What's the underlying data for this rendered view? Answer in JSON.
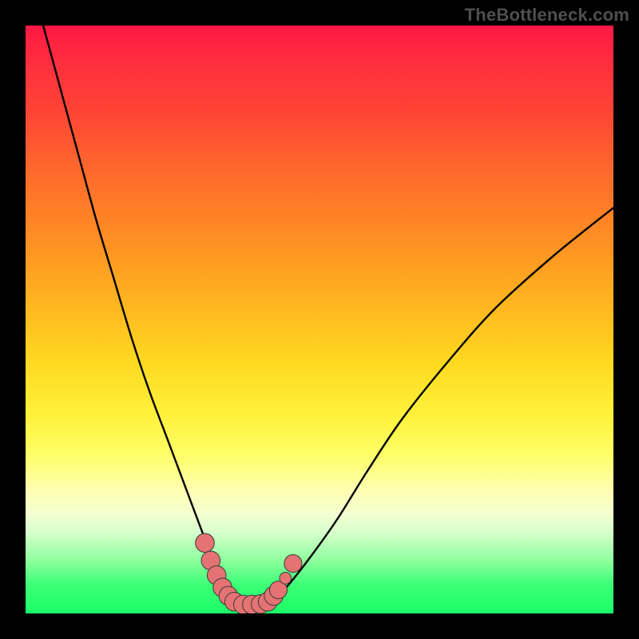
{
  "watermark": "TheBottleneck.com",
  "colors": {
    "curve_stroke": "#000000",
    "marker_fill": "#e57373",
    "marker_stroke": "#3a3a3a",
    "frame_bg": "#000000"
  },
  "chart_data": {
    "type": "line",
    "title": "",
    "xlabel": "",
    "ylabel": "",
    "xlim": [
      0,
      100
    ],
    "ylim": [
      0,
      100
    ],
    "grid": false,
    "series": [
      {
        "name": "bottleneck-curve",
        "comment": "V-shaped bottleneck percentage curve; y is percent bottleneck vs x (hardware balance). Values estimated from pixel positions.",
        "x": [
          3,
          6,
          9,
          12,
          15,
          18,
          21,
          24,
          27,
          30,
          32,
          34,
          35,
          36,
          38,
          40,
          42,
          44,
          48,
          53,
          58,
          64,
          72,
          80,
          90,
          100
        ],
        "y": [
          100,
          89,
          78,
          67,
          57,
          47,
          38,
          30,
          22,
          14,
          9,
          5,
          3,
          2,
          1.5,
          1.5,
          2,
          4,
          9,
          16,
          24,
          33,
          43,
          52,
          61,
          69
        ]
      }
    ],
    "markers": {
      "comment": "Small salmon-colored round markers clustered near the trough of the curve.",
      "points": [
        {
          "x": 30.5,
          "y": 12.0,
          "r": 1.6
        },
        {
          "x": 31.5,
          "y": 9.0,
          "r": 1.6
        },
        {
          "x": 32.5,
          "y": 6.5,
          "r": 1.6
        },
        {
          "x": 33.5,
          "y": 4.4,
          "r": 1.6
        },
        {
          "x": 34.5,
          "y": 3.0,
          "r": 1.6
        },
        {
          "x": 35.5,
          "y": 2.0,
          "r": 1.6
        },
        {
          "x": 37.0,
          "y": 1.5,
          "r": 1.6
        },
        {
          "x": 38.5,
          "y": 1.5,
          "r": 1.6
        },
        {
          "x": 40.0,
          "y": 1.6,
          "r": 1.6
        },
        {
          "x": 41.2,
          "y": 2.0,
          "r": 1.6
        },
        {
          "x": 42.2,
          "y": 3.0,
          "r": 1.6
        },
        {
          "x": 43.0,
          "y": 4.0,
          "r": 1.5
        },
        {
          "x": 44.2,
          "y": 6.0,
          "r": 1.0
        },
        {
          "x": 45.5,
          "y": 8.5,
          "r": 1.5
        }
      ]
    }
  }
}
